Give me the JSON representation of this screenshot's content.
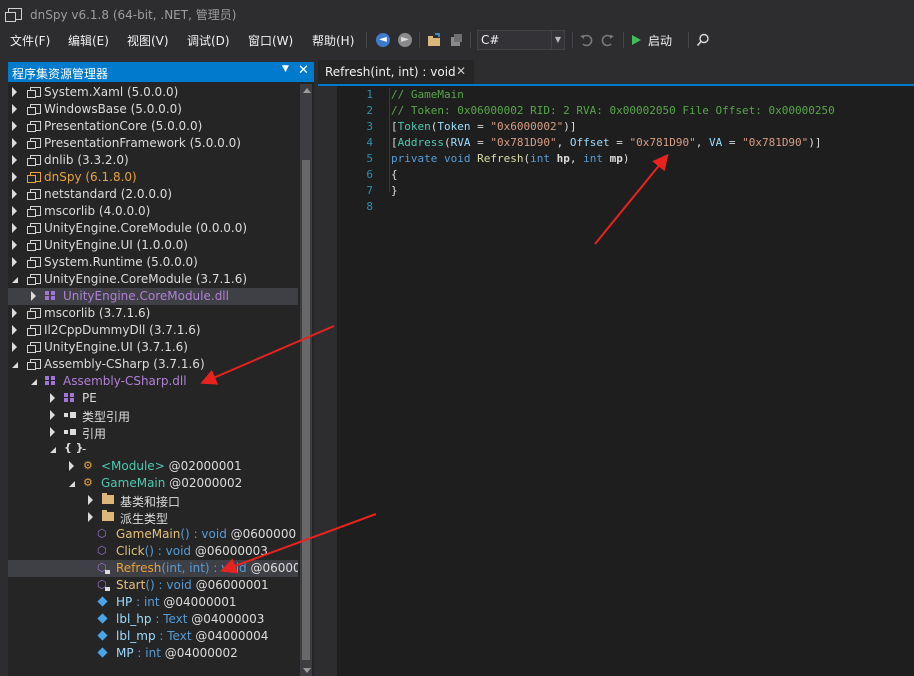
{
  "window": {
    "title": "dnSpy v6.1.8 (64-bit, .NET, 管理员)"
  },
  "menu": [
    "文件(F)",
    "编辑(E)",
    "视图(V)",
    "调试(D)",
    "窗口(W)",
    "帮助(H)"
  ],
  "toolbar": {
    "language": "C#",
    "start_label": "启动"
  },
  "panel": {
    "title": "程序集资源管理器",
    "dropdown": "▼",
    "close": "✕"
  },
  "tree": [
    {
      "text": "System.Xaml (5.0.0.0)",
      "level": 0,
      "toggle": "col",
      "icon": "asm"
    },
    {
      "text": "WindowsBase (5.0.0.0)",
      "level": 0,
      "toggle": "col",
      "icon": "asm"
    },
    {
      "text": "PresentationCore (5.0.0.0)",
      "level": 0,
      "toggle": "col",
      "icon": "asm"
    },
    {
      "text": "PresentationFramework (5.0.0.0)",
      "level": 0,
      "toggle": "col",
      "icon": "asm"
    },
    {
      "text": "dnlib (3.3.2.0)",
      "level": 0,
      "toggle": "col",
      "icon": "asm"
    },
    {
      "text": "dnSpy (6.1.8.0)",
      "level": 0,
      "toggle": "col",
      "icon": "asm-orange",
      "cls": "orange"
    },
    {
      "text": "netstandard (2.0.0.0)",
      "level": 0,
      "toggle": "col",
      "icon": "asm"
    },
    {
      "text": "mscorlib (4.0.0.0)",
      "level": 0,
      "toggle": "col",
      "icon": "asm"
    },
    {
      "text": "UnityEngine.CoreModule (0.0.0.0)",
      "level": 0,
      "toggle": "col",
      "icon": "asm"
    },
    {
      "text": "UnityEngine.UI (1.0.0.0)",
      "level": 0,
      "toggle": "col",
      "icon": "asm"
    },
    {
      "text": "System.Runtime (5.0.0.0)",
      "level": 0,
      "toggle": "col",
      "icon": "asm"
    },
    {
      "text": "UnityEngine.CoreModule (3.7.1.6)",
      "level": 0,
      "toggle": "exp",
      "icon": "asm"
    },
    {
      "text": "UnityEngine.CoreModule.dll",
      "level": 1,
      "toggle": "col",
      "icon": "mod",
      "cls": "purple",
      "selected": true
    },
    {
      "text": "mscorlib (3.7.1.6)",
      "level": 0,
      "toggle": "col",
      "icon": "asm"
    },
    {
      "text": "Il2CppDummyDll (3.7.1.6)",
      "level": 0,
      "toggle": "col",
      "icon": "asm"
    },
    {
      "text": "UnityEngine.UI (3.7.1.6)",
      "level": 0,
      "toggle": "col",
      "icon": "asm"
    },
    {
      "text": "Assembly-CSharp (3.7.1.6)",
      "level": 0,
      "toggle": "exp",
      "icon": "asm"
    },
    {
      "text": "Assembly-CSharp.dll",
      "level": 1,
      "toggle": "exp",
      "icon": "mod",
      "cls": "purple"
    },
    {
      "text": "PE",
      "level": 2,
      "toggle": "col",
      "icon": "mod"
    },
    {
      "text": "类型引用",
      "level": 2,
      "toggle": "col",
      "icon": "ref"
    },
    {
      "text": "引用",
      "level": 2,
      "toggle": "col",
      "icon": "ref"
    },
    {
      "text": "-",
      "level": 2,
      "toggle": "exp",
      "icon": "ns"
    },
    {
      "text": "<Module>",
      "suffix": " @02000001",
      "level": 3,
      "toggle": "col",
      "icon": "cls",
      "cls": "teal"
    },
    {
      "text": "GameMain",
      "suffix": " @02000002",
      "level": 3,
      "toggle": "exp",
      "icon": "cls",
      "cls": "teal"
    },
    {
      "text": "基类和接口",
      "level": 4,
      "toggle": "col",
      "icon": "folder"
    },
    {
      "text": "派生类型",
      "level": 4,
      "toggle": "col",
      "icon": "folder"
    },
    {
      "text": "GameMain",
      "args": "()",
      "type": " : void",
      "suffix": " @0600000",
      "level": 4,
      "icon": "method",
      "cls": "mgold"
    },
    {
      "text": "Click",
      "args": "()",
      "type": " : void",
      "suffix": " @06000003",
      "level": 4,
      "icon": "method",
      "cls": "mgold"
    },
    {
      "text": "Refresh",
      "args": "(int, int)",
      "type": " : void",
      "suffix": " @06000",
      "level": 4,
      "icon": "method-lock",
      "cls": "orange",
      "selected": true
    },
    {
      "text": "Start",
      "args": "()",
      "type": " : void",
      "suffix": " @06000001",
      "level": 4,
      "icon": "method-lock",
      "cls": "mgold"
    },
    {
      "text": "HP",
      "type": " : int",
      "suffix": " @04000001",
      "level": 4,
      "icon": "field",
      "cls": "fblue"
    },
    {
      "text": "lbl_hp",
      "type": " : Text",
      "suffix": " @04000003",
      "level": 4,
      "icon": "field",
      "cls": "fblue"
    },
    {
      "text": "lbl_mp",
      "type": " : Text",
      "suffix": " @04000004",
      "level": 4,
      "icon": "field",
      "cls": "fblue"
    },
    {
      "text": "MP",
      "type": " : int",
      "suffix": " @04000002",
      "level": 4,
      "icon": "field",
      "cls": "fblue"
    }
  ],
  "editor": {
    "tab_label": "Refresh(int, int) : void",
    "tab_close": "✕",
    "line_numbers": [
      "1",
      "2",
      "3",
      "4",
      "5",
      "6",
      "7",
      "8"
    ],
    "code": [
      [
        {
          "t": "// GameMain",
          "c": "c-com"
        }
      ],
      [
        {
          "t": "// Token: 0x06000002 RID: 2 RVA: 0x00002050 File Offset: 0x00000250",
          "c": "c-com"
        }
      ],
      [
        {
          "t": "[",
          "c": ""
        },
        {
          "t": "Token",
          "c": "c-type"
        },
        {
          "t": "(",
          "c": ""
        },
        {
          "t": "Token",
          "c": "c-prop"
        },
        {
          "t": " = ",
          "c": ""
        },
        {
          "t": "\"0x6000002\"",
          "c": "c-str"
        },
        {
          "t": ")]",
          "c": ""
        }
      ],
      [
        {
          "t": "[",
          "c": ""
        },
        {
          "t": "Address",
          "c": "c-type"
        },
        {
          "t": "(",
          "c": ""
        },
        {
          "t": "RVA",
          "c": "c-prop"
        },
        {
          "t": " = ",
          "c": ""
        },
        {
          "t": "\"0x781D90\"",
          "c": "c-str"
        },
        {
          "t": ", ",
          "c": ""
        },
        {
          "t": "Offset",
          "c": "c-prop"
        },
        {
          "t": " = ",
          "c": ""
        },
        {
          "t": "\"0x781D90\"",
          "c": "c-str"
        },
        {
          "t": ", ",
          "c": ""
        },
        {
          "t": "VA",
          "c": "c-prop"
        },
        {
          "t": " = ",
          "c": ""
        },
        {
          "t": "\"0x781D90\"",
          "c": "c-str"
        },
        {
          "t": ")]",
          "c": ""
        }
      ],
      [
        {
          "t": "private",
          "c": "c-kw"
        },
        {
          "t": " ",
          "c": ""
        },
        {
          "t": "void",
          "c": "c-kw"
        },
        {
          "t": " ",
          "c": ""
        },
        {
          "t": "Refresh",
          "c": "c-meth"
        },
        {
          "t": "(",
          "c": ""
        },
        {
          "t": "int",
          "c": "c-kw"
        },
        {
          "t": " ",
          "c": ""
        },
        {
          "t": "hp",
          "c": "c-par"
        },
        {
          "t": ", ",
          "c": ""
        },
        {
          "t": "int",
          "c": "c-kw"
        },
        {
          "t": " ",
          "c": ""
        },
        {
          "t": "mp",
          "c": "c-par"
        },
        {
          "t": ")",
          "c": ""
        }
      ],
      [
        {
          "t": "{",
          "c": ""
        }
      ],
      [
        {
          "t": "}",
          "c": ""
        }
      ],
      []
    ]
  },
  "colors": {
    "accent": "#007acc",
    "annotation_arrow": "#e8221f"
  }
}
